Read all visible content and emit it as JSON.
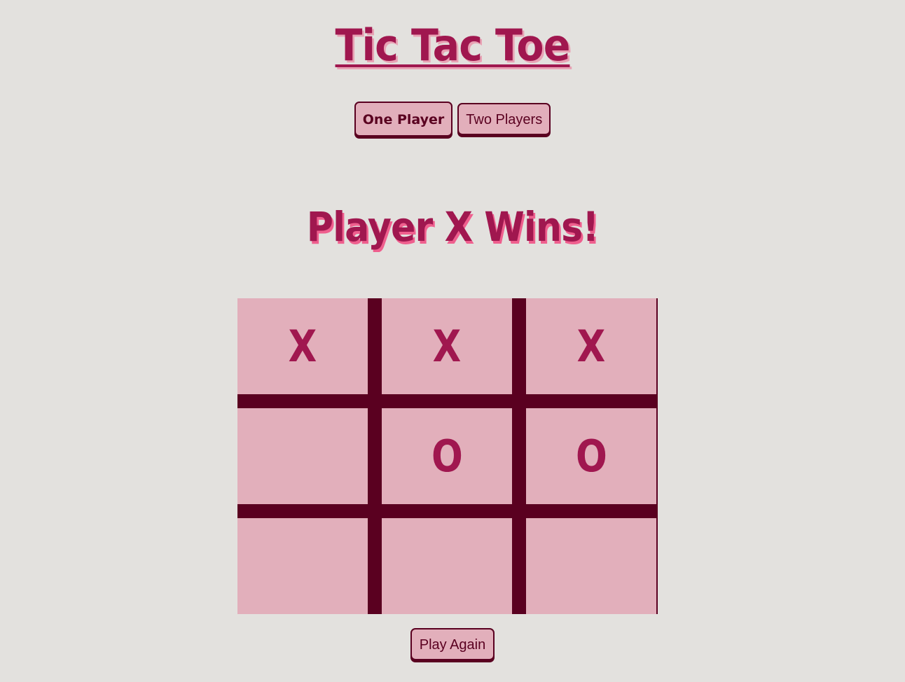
{
  "header": {
    "title": "Tic Tac Toe"
  },
  "modes": {
    "one_player_label": "One Player",
    "two_players_label": "Two Players",
    "selected": "One Player"
  },
  "status": {
    "message": "Player X Wins!"
  },
  "board": {
    "cells": [
      "X",
      "X",
      "X",
      "",
      "O",
      "O",
      "",
      "",
      ""
    ]
  },
  "actions": {
    "play_again_label": "Play Again"
  },
  "colors": {
    "background": "#e3e1de",
    "accent": "#a0174f",
    "cell": "#e2afbb",
    "grid_lines": "#5a0020",
    "status_shadow": "#ef5f8e"
  }
}
